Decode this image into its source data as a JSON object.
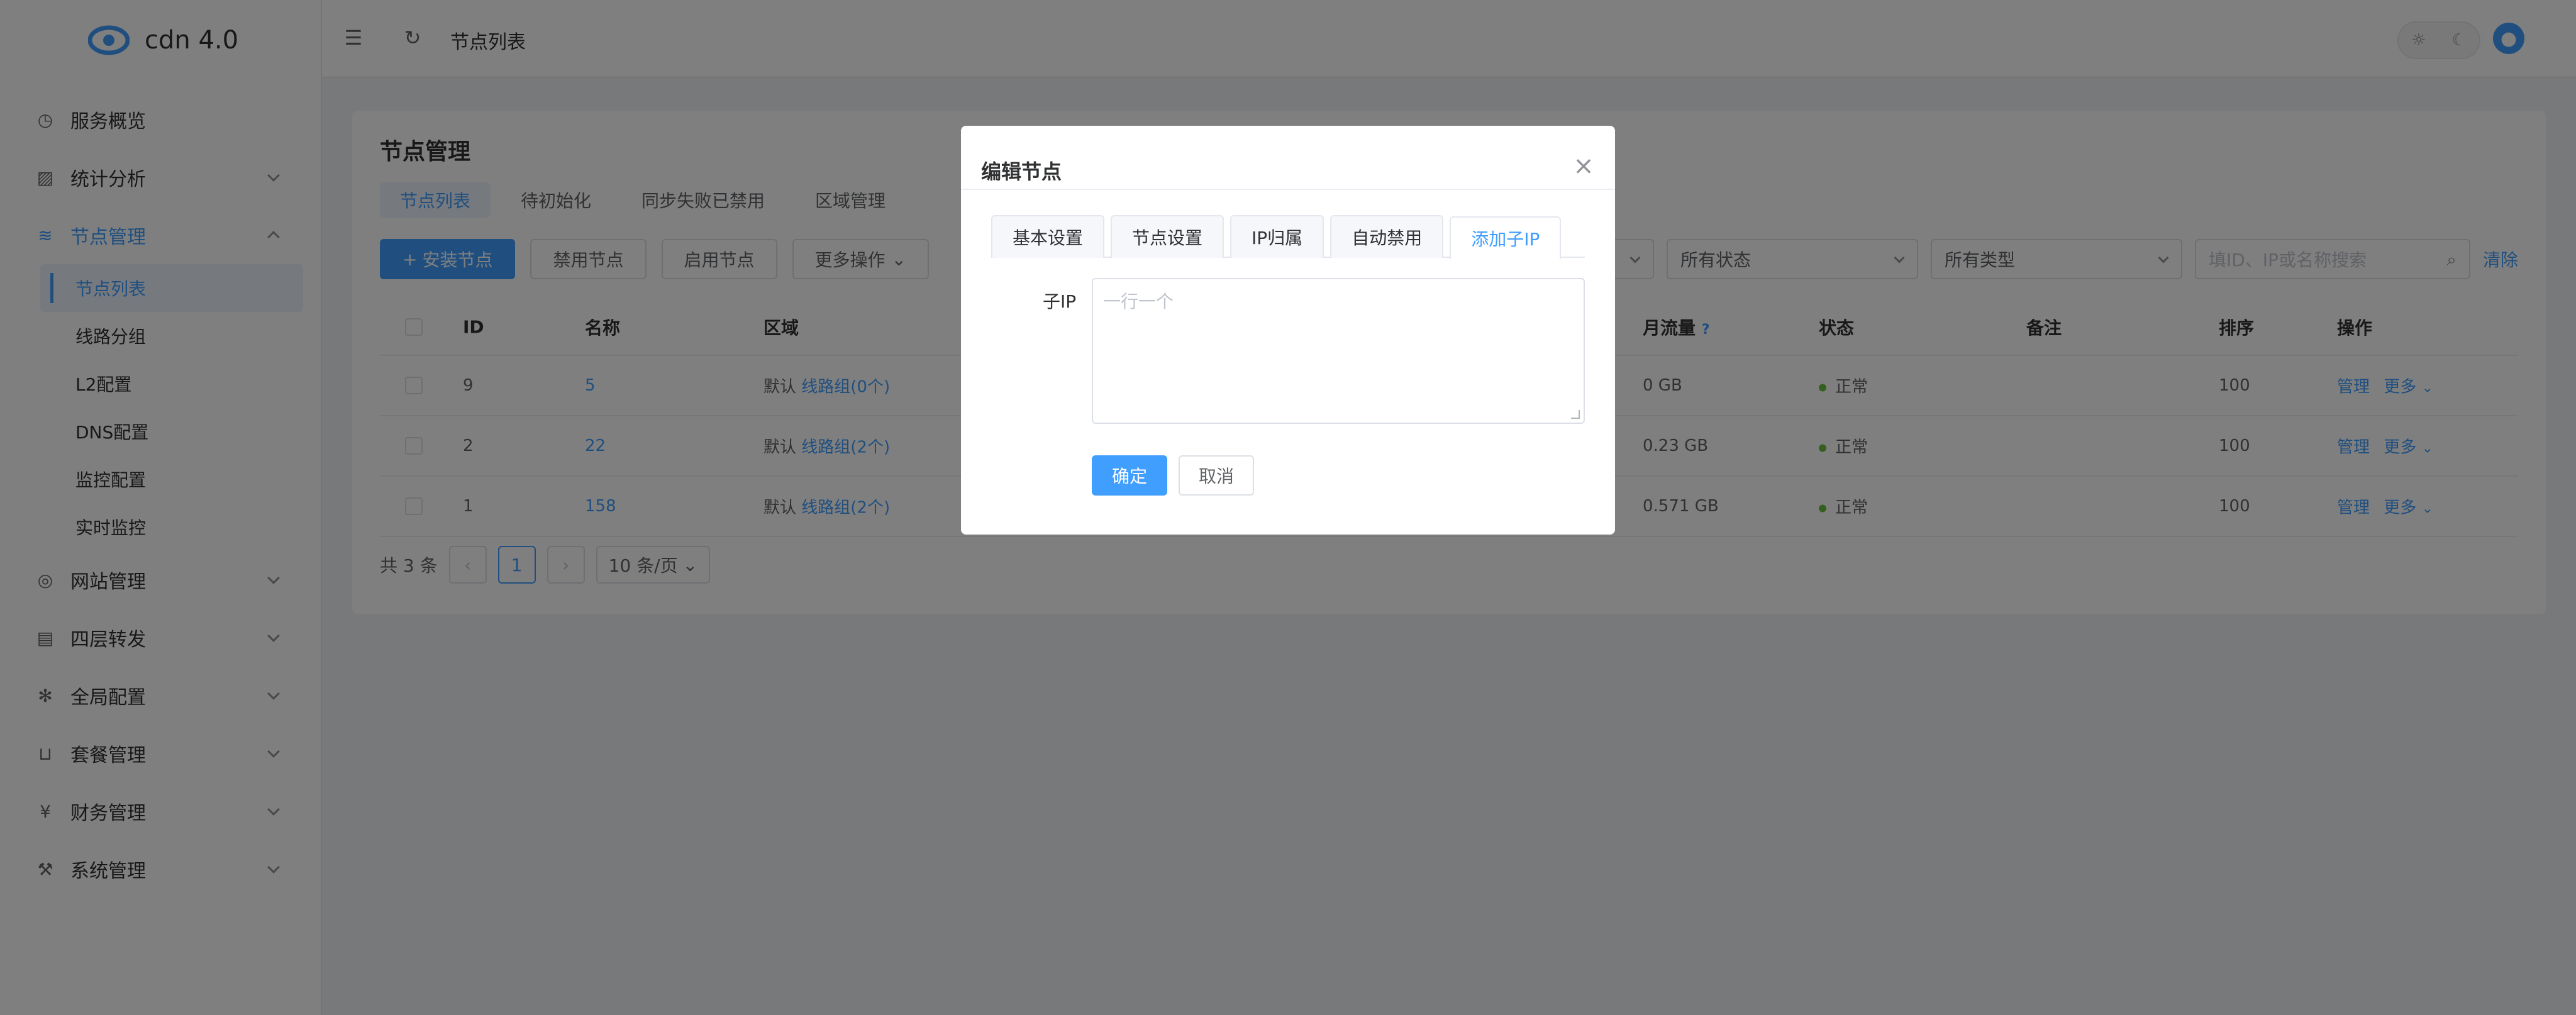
{
  "app": {
    "title": "cdn 4.0"
  },
  "sidebar": {
    "items": [
      {
        "label": "服务概览",
        "icon": "clock-icon"
      },
      {
        "label": "统计分析",
        "icon": "chart-icon"
      },
      {
        "label": "节点管理",
        "icon": "layers-icon"
      },
      {
        "label": "网站管理",
        "icon": "globe-icon"
      },
      {
        "label": "四层转发",
        "icon": "server-icon"
      },
      {
        "label": "全局配置",
        "icon": "gear-icon"
      },
      {
        "label": "套餐管理",
        "icon": "basket-icon"
      },
      {
        "label": "财务管理",
        "icon": "yen-icon"
      },
      {
        "label": "系统管理",
        "icon": "wrench-icon"
      }
    ],
    "sub_items": [
      {
        "label": "节点列表"
      },
      {
        "label": "线路分组"
      },
      {
        "label": "L2配置"
      },
      {
        "label": "DNS配置"
      },
      {
        "label": "监控配置"
      },
      {
        "label": "实时监控"
      }
    ]
  },
  "topbar": {
    "page_title": "节点列表"
  },
  "page": {
    "title": "节点管理",
    "tabs": [
      {
        "label": "节点列表"
      },
      {
        "label": "待初始化"
      },
      {
        "label": "同步失败已禁用"
      },
      {
        "label": "区域管理"
      }
    ],
    "toolbar": {
      "install": "安装节点",
      "disable": "禁用节点",
      "enable": "启用节点",
      "more": "更多操作"
    },
    "filters": {
      "status": "所有状态",
      "type": "所有类型",
      "search_placeholder": "填ID、IP或名称搜索",
      "clear": "清除"
    },
    "table": {
      "headers": {
        "id": "ID",
        "name": "名称",
        "region": "区域",
        "traffic": "月流量",
        "traffic_hint": "?",
        "status": "状态",
        "remark": "备注",
        "sort": "排序",
        "ops": "操作"
      },
      "rows": [
        {
          "id": "9",
          "name": "5",
          "region": "默认",
          "group": "线路组(0个)",
          "traffic": "0 GB",
          "status": "正常",
          "sort": "100",
          "manage": "管理",
          "more": "更多"
        },
        {
          "id": "2",
          "name": "22",
          "region": "默认",
          "group": "线路组(2个)",
          "traffic": "0.23 GB",
          "status": "正常",
          "sort": "100",
          "manage": "管理",
          "more": "更多"
        },
        {
          "id": "1",
          "name": "158",
          "region": "默认",
          "group": "线路组(2个)",
          "traffic": "0.571 GB",
          "status": "正常",
          "sort": "100",
          "manage": "管理",
          "more": "更多"
        }
      ]
    },
    "pager": {
      "total": "共 3 条",
      "current": "1",
      "page_size": "10 条/页"
    }
  },
  "dialog": {
    "title": "编辑节点",
    "tabs": [
      {
        "label": "基本设置"
      },
      {
        "label": "节点设置"
      },
      {
        "label": "IP归属"
      },
      {
        "label": "自动禁用"
      },
      {
        "label": "添加子IP"
      }
    ],
    "field_label": "子IP",
    "placeholder": "一行一个",
    "confirm": "确定",
    "cancel": "取消"
  },
  "colors": {
    "primary": "#409eff",
    "success": "#67c23a"
  }
}
